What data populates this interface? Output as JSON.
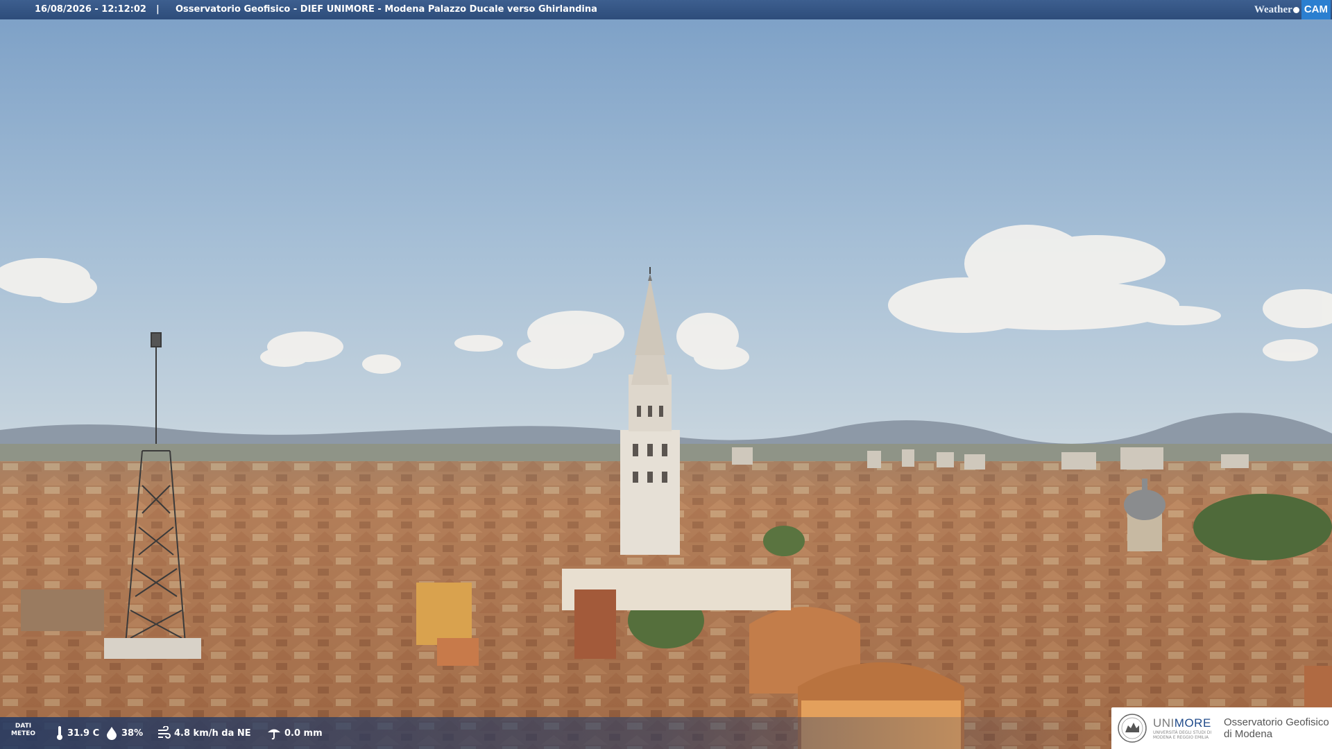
{
  "header": {
    "timestamp": "16/08/2026 - 12:12:02",
    "separator": "|",
    "camera_title": "Osservatorio Geofisico - DIEF UNIMORE - Modena Palazzo Ducale verso Ghirlandina"
  },
  "brand": {
    "weather": "Weather",
    "cam": "CAM"
  },
  "weather_bar": {
    "label_line1": "DATI",
    "label_line2": "METEO",
    "temperature": "31.9 C",
    "humidity": "38%",
    "wind": "4.8 km/h da NE",
    "rain": "0.0 mm"
  },
  "logo": {
    "uni_a": "UNI",
    "uni_b": "MORE",
    "uni_sub": "UNIVERSITÀ DEGLI STUDI DI MODENA E REGGIO EMILIA",
    "osservatorio_line1": "Osservatorio Geofisico",
    "osservatorio_line2": "di Modena"
  },
  "icons": [
    "thermometer-icon",
    "humidity-drop-icon",
    "wind-icon",
    "rain-icon",
    "unimore-seal-icon"
  ],
  "colors": {
    "sky_top": "#7fa3c9",
    "sky_horizon": "#c4d3de",
    "roof": "#b9805a",
    "header_bar": "#2d4c7a",
    "brand_blue": "#2b7fd0"
  }
}
